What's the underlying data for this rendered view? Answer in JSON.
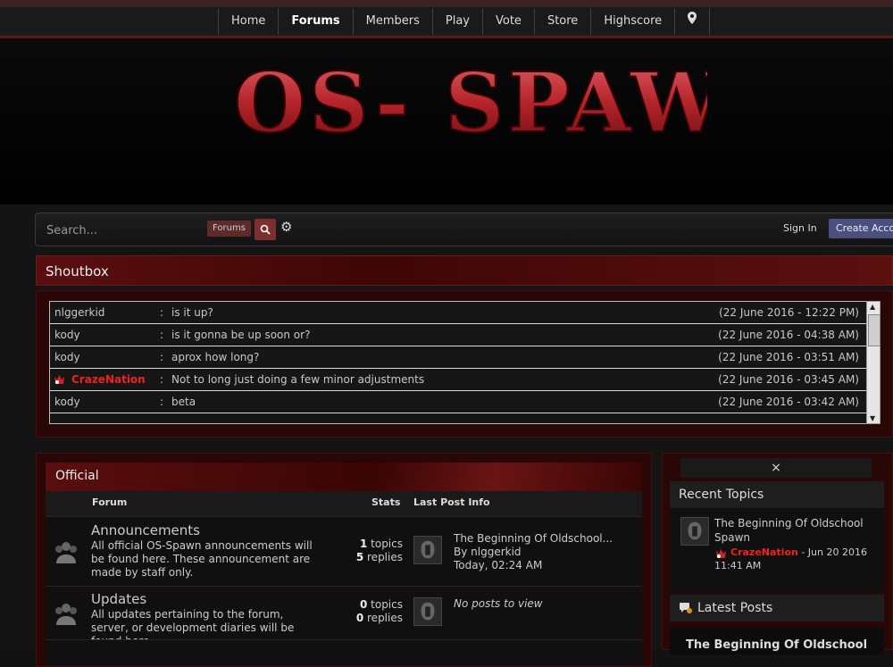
{
  "nav": {
    "items": [
      "Home",
      "Forums",
      "Members",
      "Play",
      "Vote",
      "Store",
      "Highscore"
    ],
    "active": "Forums"
  },
  "logo": {
    "text": "OS- SPAWN"
  },
  "search": {
    "placeholder": "Search...",
    "scope": "Forums",
    "sign_in": "Sign In",
    "create_account": "Create Acco"
  },
  "shoutbox": {
    "title": "Shoutbox",
    "messages": [
      {
        "user": "nlggerkid",
        "text": "is it up?",
        "time": "(22 June 2016 - 12:22 PM)"
      },
      {
        "user": "kody",
        "text": "is it gonna be up soon or?",
        "time": "(22 June 2016 - 04:38 AM)"
      },
      {
        "user": "kody",
        "text": "aprox how long?",
        "time": "(22 June 2016 - 03:51 AM)"
      },
      {
        "user": "CrazeNation",
        "text": "Not to long just doing a few minor adjustments",
        "time": "(22 June 2016 - 03:45 AM)"
      },
      {
        "user": "kody",
        "text": "beta",
        "time": "(22 June 2016 - 03:42 AM)"
      }
    ]
  },
  "forum": {
    "section_title": "Official",
    "columns": {
      "forum": "Forum",
      "stats": "Stats",
      "last_post": "Last Post Info"
    },
    "rows": [
      {
        "name": "Announcements",
        "desc": "All official OS-Spawn announcements will be found here. These announcement are made by staff only.",
        "topics": "1",
        "replies": "5",
        "topics_label": "topics",
        "replies_label": "replies",
        "last_title": "The Beginning Of Oldschool...",
        "last_by": "By nlggerkid",
        "last_time": "Today, 02:24 AM"
      },
      {
        "name": "Updates",
        "desc": "All updates pertaining to the forum, server, or development diaries will be found here.",
        "topics": "0",
        "replies": "0",
        "topics_label": "topics",
        "replies_label": "replies",
        "no_posts": "No posts to view"
      }
    ]
  },
  "sidebar": {
    "close": "×",
    "recent_topics": {
      "title": "Recent Topics",
      "topic": "The Beginning Of Oldschool Spawn",
      "user": "CrazeNation",
      "date": "- Jun 20 2016",
      "time": "11:41 AM"
    },
    "latest_posts": {
      "title": "Latest Posts",
      "first": "The Beginning Of Oldschool"
    }
  },
  "colors": {
    "accent_red": "#b4242a",
    "staff_name": "#e22222",
    "panel_dark_red": "#2a0707"
  }
}
